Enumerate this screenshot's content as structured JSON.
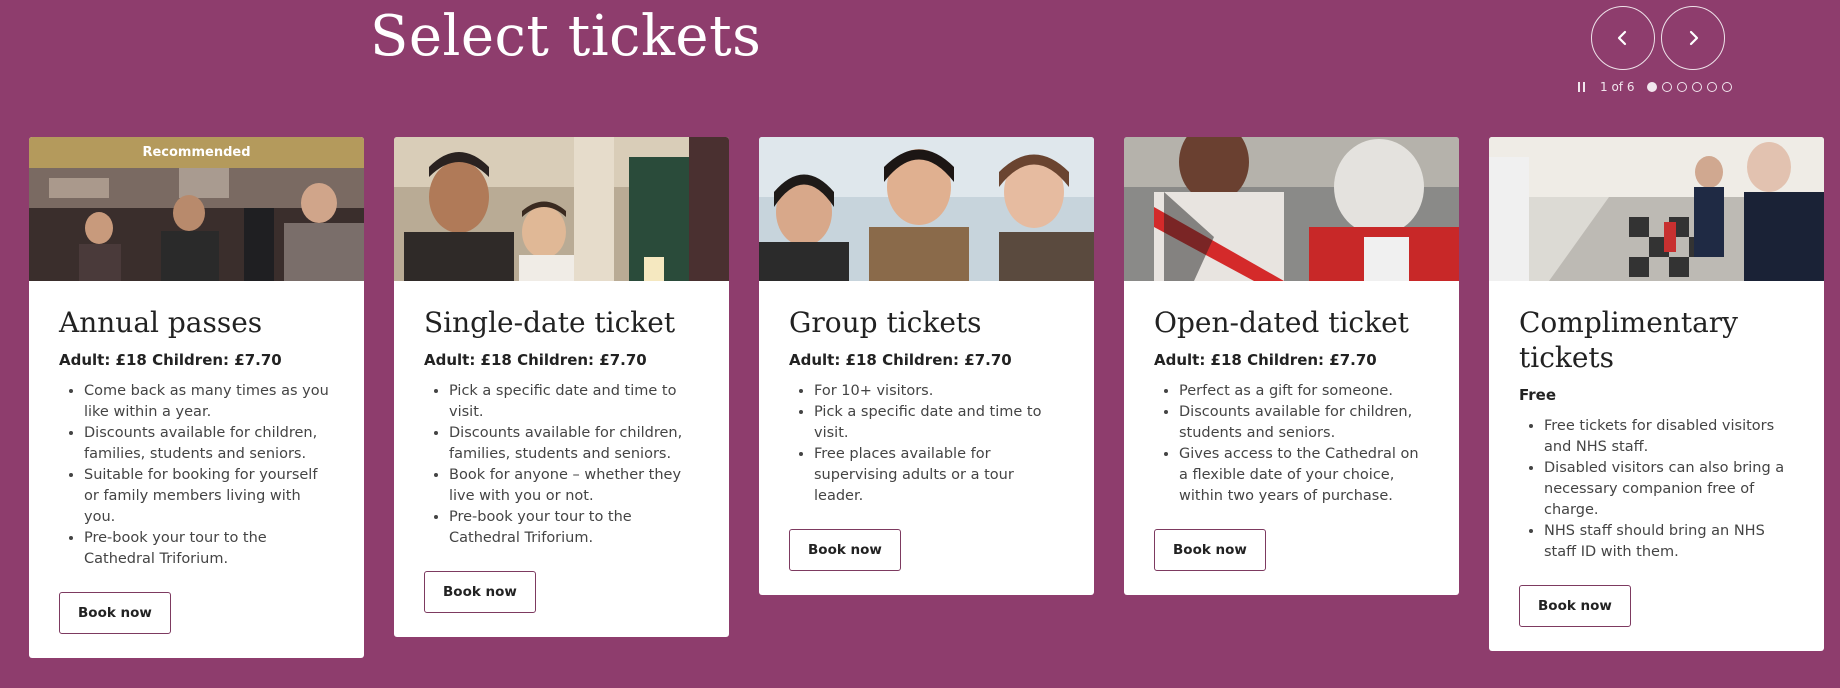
{
  "page": {
    "title": "Select tickets"
  },
  "carousel": {
    "prev_label": "Previous",
    "next_label": "Next",
    "counter": "1 of 6",
    "dots": [
      true,
      false,
      false,
      false,
      false,
      false
    ]
  },
  "cards": [
    {
      "badge": "Recommended",
      "title": "Annual passes",
      "price": "Adult: £18  Children: £7.70",
      "features": [
        "Come back as many times as you like within a year.",
        "Discounts available for children, families, students and seniors.",
        "Suitable for booking for yourself or family members living with you.",
        "Pre-book your tour to the Cathedral Triforium."
      ],
      "button": "Book now"
    },
    {
      "title": "Single-date ticket",
      "price": "Adult: £18  Children: £7.70",
      "features": [
        "Pick a specific date and time to visit.",
        "Discounts available for children, families, students and seniors.",
        "Book for anyone – whether they live with you or not.",
        "Pre-book your tour to the Cathedral Triforium."
      ],
      "button": "Book now"
    },
    {
      "title": "Group tickets",
      "price": "Adult: £18  Children: £7.70",
      "features": [
        "For 10+ visitors.",
        "Pick a specific date and time to visit.",
        "Free places available for supervising adults or a tour leader."
      ],
      "button": "Book now"
    },
    {
      "title": "Open-dated ticket",
      "price": "Adult: £18  Children: £7.70",
      "features": [
        "Perfect as a gift for someone.",
        "Discounts available for children, students and seniors.",
        "Gives access to the Cathedral on a flexible date of your choice, within two years of purchase."
      ],
      "button": "Book now"
    },
    {
      "title": "Complimentary tickets",
      "price": "Free",
      "features": [
        "Free tickets for disabled visitors and NHS staff.",
        "Disabled visitors can also bring a necessary companion free of charge.",
        "NHS staff should bring an NHS staff ID with them."
      ],
      "button": "Book now"
    }
  ]
}
